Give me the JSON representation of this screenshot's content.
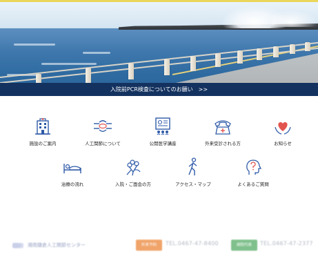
{
  "banner": {
    "text": "入院前PCR検査についてのお願い",
    "arrow": ">>"
  },
  "menu_row1": [
    {
      "label": "施設のご案内",
      "icon": "building-icon"
    },
    {
      "label": "人工関節について",
      "icon": "joint-icon"
    },
    {
      "label": "公開医学講座",
      "icon": "lecture-board-icon"
    },
    {
      "label": "外来受診される方",
      "icon": "telephone-icon"
    },
    {
      "label": "お知らせ",
      "icon": "heart-hands-icon"
    }
  ],
  "menu_row2": [
    {
      "label": "治療の流れ",
      "icon": "bed-icon"
    },
    {
      "label": "入院・ご面会の方",
      "icon": "flower-bouquet-icon"
    },
    {
      "label": "アクセス・マップ",
      "icon": "walking-person-icon"
    },
    {
      "label": "よくあるご質問",
      "icon": "head-question-icon"
    }
  ],
  "footer": {
    "name": "湘南鎌倉人工関節センター",
    "badge1": "外来予約",
    "tel1": "TEL.0467-47-8400",
    "badge2": "病院代表",
    "tel2": "TEL.0467-47-2377",
    "badge1_color": "#f0a46a",
    "badge2_color": "#7fc08c"
  },
  "colors": {
    "banner_bg": "#14325f",
    "icon_blue": "#2e5aa8",
    "accent_red": "#e2554f"
  }
}
